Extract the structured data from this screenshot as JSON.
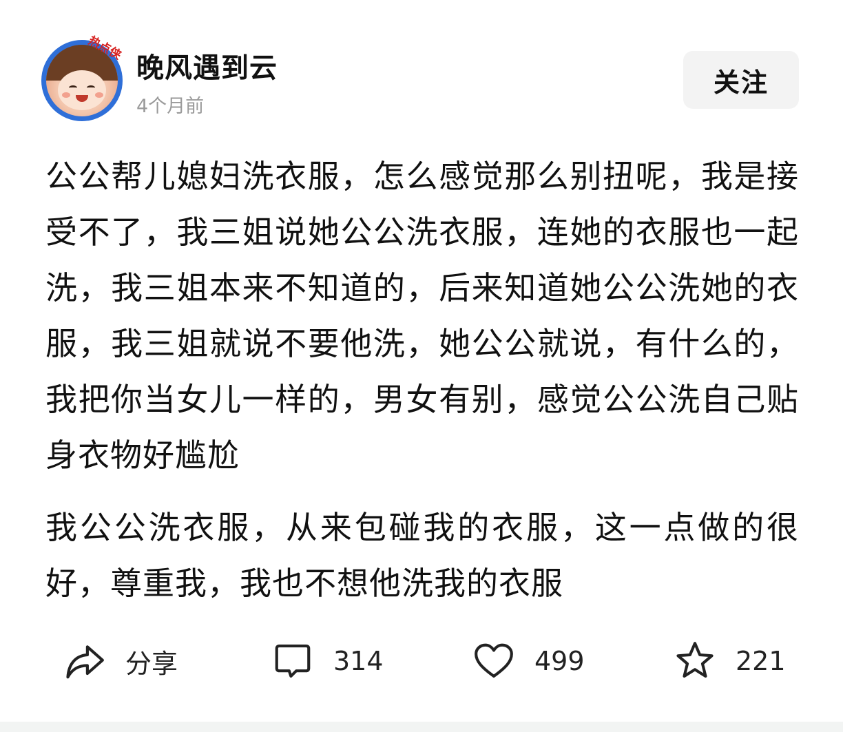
{
  "author": {
    "name": "晚风遇到云",
    "time": "4个月前",
    "avatar_badge": "热点侠"
  },
  "follow_button": {
    "label": "关注"
  },
  "post": {
    "paragraphs": [
      "公公帮儿媳妇洗衣服，怎么感觉那么别扭呢，我是接受不了，我三姐说她公公洗衣服，连她的衣服也一起洗，我三姐本来不知道的，后来知道她公公洗她的衣服，我三姐就说不要他洗，她公公就说，有什么的，我把你当女儿一样的，男女有别，感觉公公洗自己贴身衣物好尴尬",
      "我公公洗衣服，从来包碰我的衣服，这一点做的很好，尊重我，我也不想他洗我的衣服"
    ]
  },
  "actions": {
    "share": {
      "label": "分享",
      "icon": "share-icon"
    },
    "comment": {
      "count": "314",
      "icon": "comment-icon"
    },
    "like": {
      "count": "499",
      "icon": "heart-icon"
    },
    "favorite": {
      "count": "221",
      "icon": "star-icon"
    }
  }
}
